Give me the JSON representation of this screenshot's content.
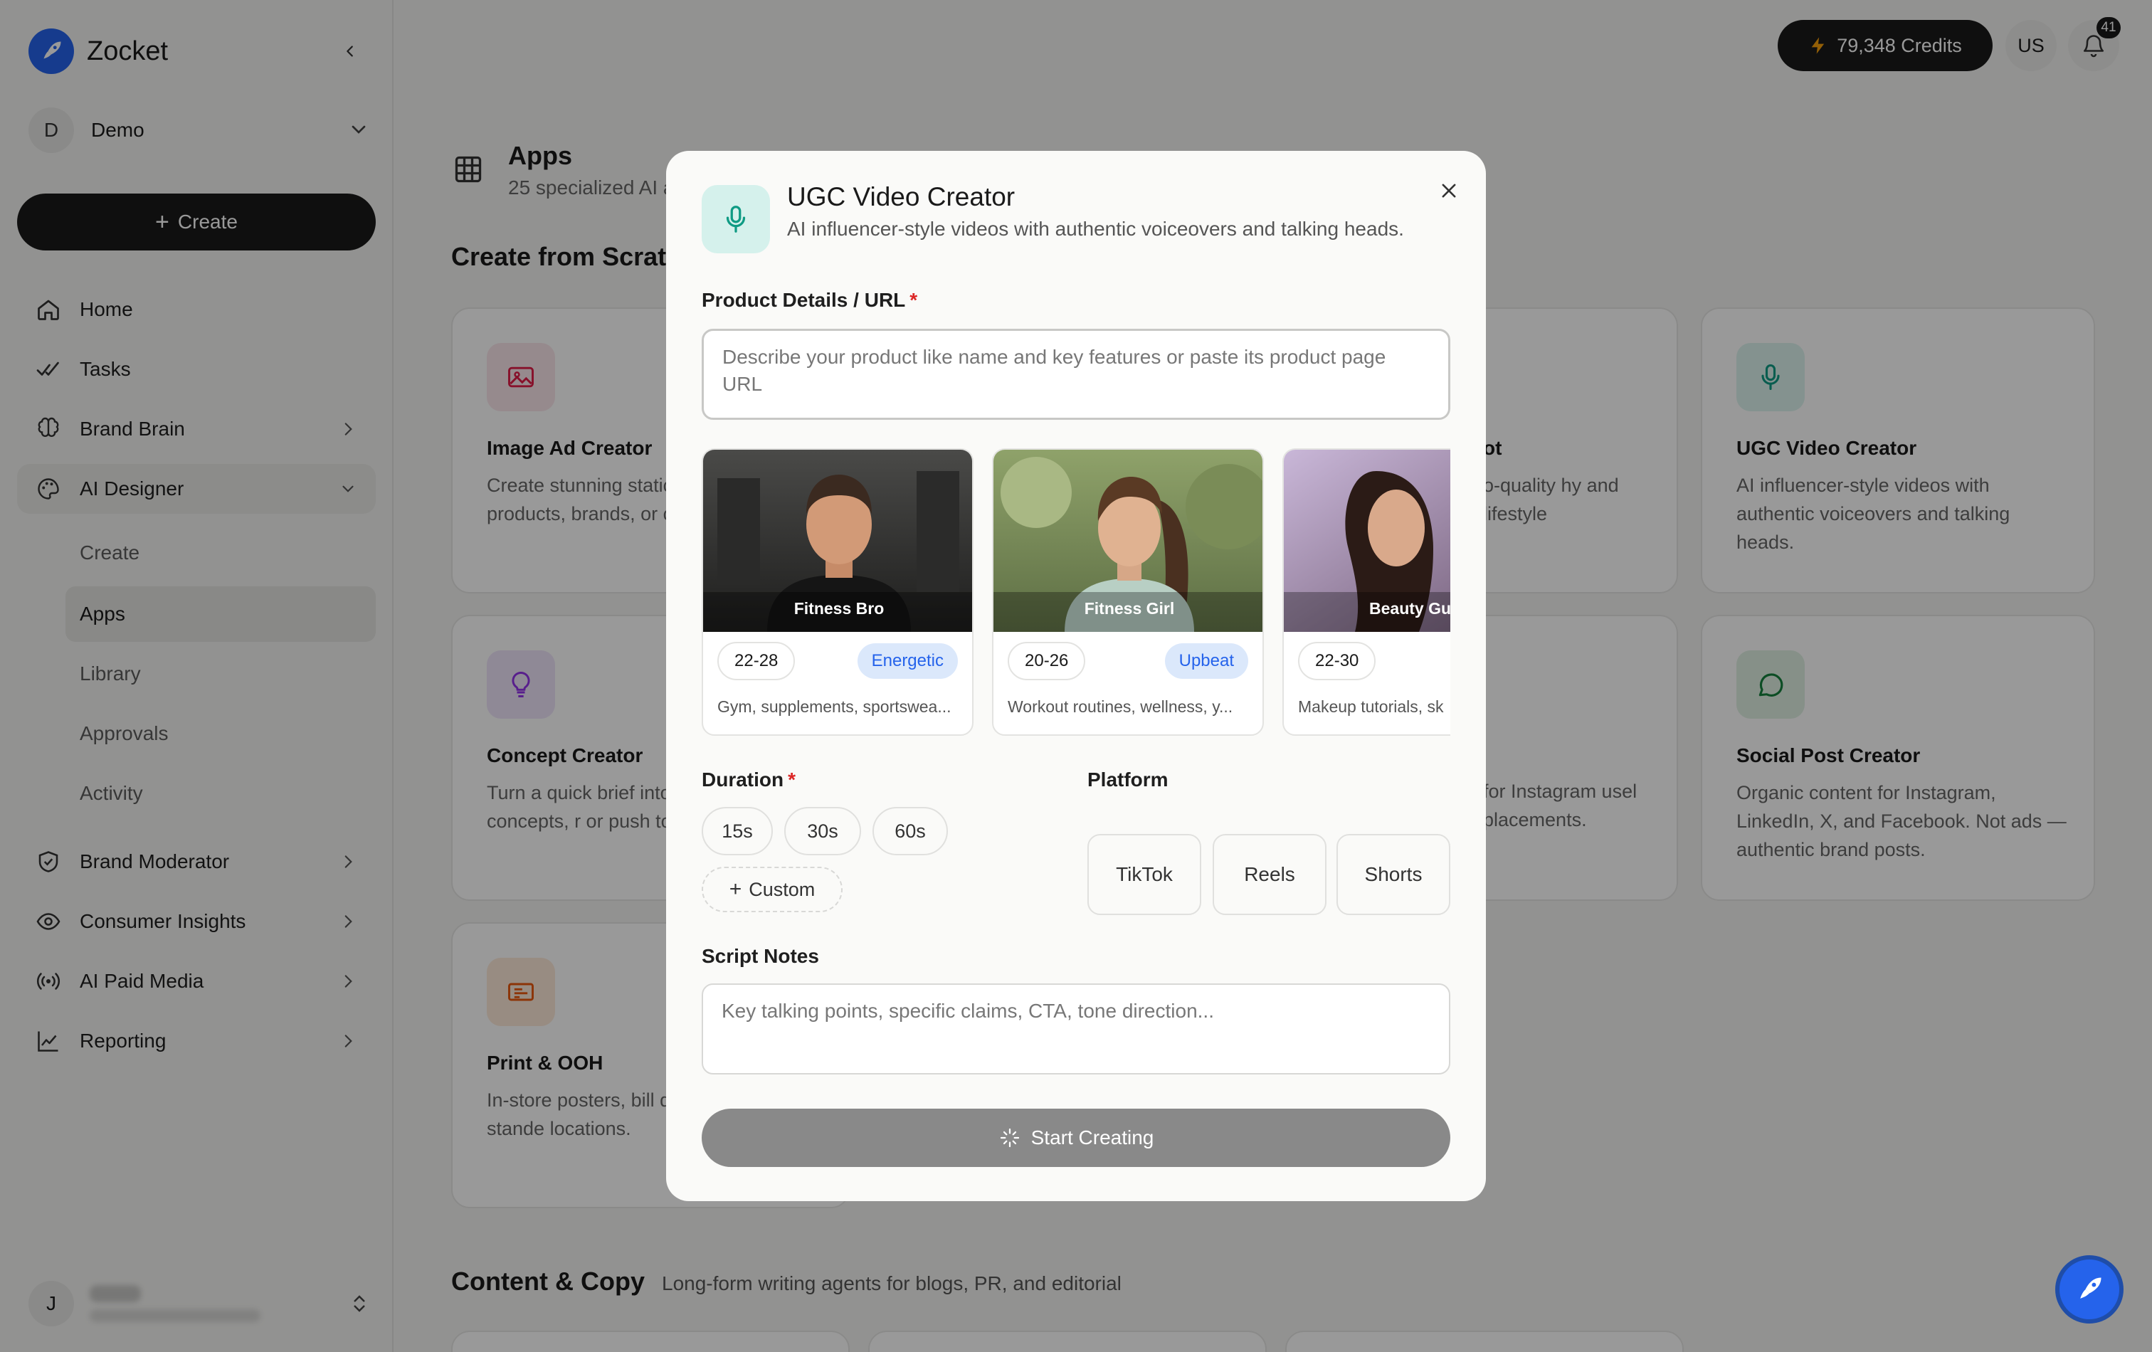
{
  "app": {
    "name": "Zocket"
  },
  "workspace": {
    "initial": "D",
    "name": "Demo"
  },
  "sidebar": {
    "create_label": "Create",
    "nav": [
      {
        "label": "Home"
      },
      {
        "label": "Tasks"
      },
      {
        "label": "Brand Brain"
      },
      {
        "label": "AI Designer"
      },
      {
        "label": "Brand Moderator"
      },
      {
        "label": "Consumer Insights"
      },
      {
        "label": "AI Paid Media"
      },
      {
        "label": "Reporting"
      }
    ],
    "ai_designer_sub": [
      {
        "label": "Create"
      },
      {
        "label": "Apps"
      },
      {
        "label": "Library"
      },
      {
        "label": "Approvals"
      },
      {
        "label": "Activity"
      }
    ],
    "user": {
      "initial": "J"
    }
  },
  "topbar": {
    "credits": "79,348 Credits",
    "locale": "US",
    "notifications": "41"
  },
  "main": {
    "title": "Apps",
    "subtitle": "25 specialized AI a",
    "section_title": "Create from Scratc",
    "cards": [
      {
        "title": "Image Ad Creator",
        "desc": "Create stunning static ads for your products, brands, or campaigns.",
        "icon": "image-icon"
      },
      {
        "title": "ot",
        "desc": "o-quality hy and lifestyle"
      },
      {
        "title": "UGC Video Creator",
        "desc": "AI influencer-style videos with authentic voiceovers and talking heads.",
        "icon": "mic-icon"
      },
      {
        "title": "Concept Creator",
        "desc": "Turn a quick brief into creative concepts, r or push to productic",
        "icon": "lightbulb-icon"
      },
      {
        "title": "",
        "desc": "for Instagram usel placements."
      },
      {
        "title": "Social Post Creator",
        "desc": "Organic content for Instagram, LinkedIn, X, and Facebook. Not ads — authentic brand posts.",
        "icon": "chat-bubble-icon"
      },
      {
        "title": "Print & OOH",
        "desc": "In-store posters, bill displays, and stande locations.",
        "icon": "billboard-icon"
      }
    ],
    "section2_title": "Content & Copy",
    "section2_subtitle": "Long-form writing agents for blogs, PR, and editorial"
  },
  "modal": {
    "title": "UGC Video Creator",
    "subtitle": "AI influencer-style videos with authentic voiceovers and talking heads.",
    "product_label": "Product Details / URL",
    "required_mark": "*",
    "product_placeholder": "Describe your product like name and key features or paste its product page URL",
    "avatars": [
      {
        "name": "Fitness Bro",
        "age": "22-28",
        "tone": "Energetic",
        "desc": "Gym, supplements, sportswea..."
      },
      {
        "name": "Fitness Girl",
        "age": "20-26",
        "tone": "Upbeat",
        "desc": "Workout routines, wellness, y..."
      },
      {
        "name": "Beauty Gu",
        "age": "22-30",
        "tone": "",
        "desc": "Makeup tutorials, sk"
      }
    ],
    "duration_label": "Duration",
    "durations": [
      "15s",
      "30s",
      "60s"
    ],
    "custom_label": "Custom",
    "platform_label": "Platform",
    "platforms": [
      "TikTok",
      "Reels",
      "Shorts"
    ],
    "notes_label": "Script Notes",
    "notes_placeholder": "Key talking points, specific claims, CTA, tone direction...",
    "start_label": "Start Creating"
  },
  "colors": {
    "accent": "#2563eb",
    "dark": "#1a1a1a",
    "teal": "#0f9b84",
    "required": "#dc2626"
  }
}
